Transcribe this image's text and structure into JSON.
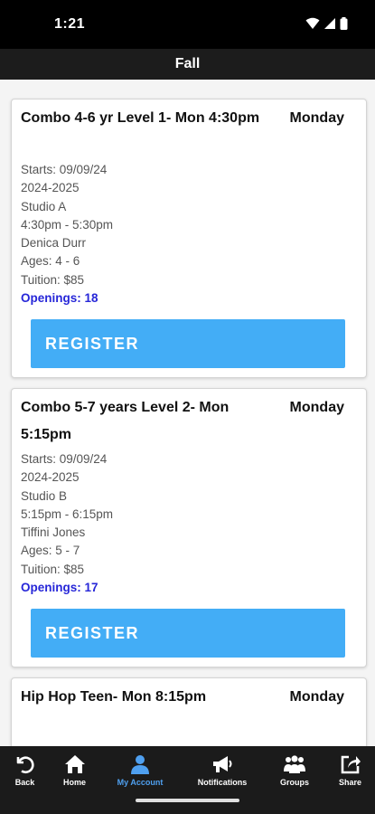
{
  "status_bar": {
    "time": "1:21"
  },
  "header": {
    "title": "Fall"
  },
  "classes": [
    {
      "title": "Combo 4-6 yr Level 1- Mon 4:30pm",
      "day": "Monday",
      "starts": "Starts: 09/09/24",
      "season": "2024-2025",
      "studio": "Studio A",
      "time": "4:30pm - 5:30pm",
      "instructor": "Denica Durr",
      "ages": "Ages: 4 - 6",
      "tuition": "Tuition: $85",
      "openings": "Openings: 18",
      "register_label": "REGISTER"
    },
    {
      "title": "Combo 5-7 years Level 2- Mon 5:15pm",
      "day": "Monday",
      "starts": "Starts: 09/09/24",
      "season": "2024-2025",
      "studio": "Studio B",
      "time": "5:15pm - 6:15pm",
      "instructor": "Tiffini Jones",
      "ages": "Ages: 5 - 7",
      "tuition": "Tuition: $85",
      "openings": "Openings: 17",
      "register_label": "REGISTER"
    },
    {
      "title": "Hip Hop Teen- Mon 8:15pm",
      "day": "Monday"
    }
  ],
  "bottom_nav": {
    "active_color": "#4fa0f0",
    "items": [
      {
        "label": "Back",
        "icon": "back-icon"
      },
      {
        "label": "Home",
        "icon": "home-icon"
      },
      {
        "label": "My Account",
        "icon": "account-icon",
        "active": true
      },
      {
        "label": "Notifications",
        "icon": "megaphone-icon"
      },
      {
        "label": "Groups",
        "icon": "groups-icon"
      },
      {
        "label": "Share",
        "icon": "share-icon"
      }
    ]
  },
  "colors": {
    "register": "#43adf6",
    "openings": "#2727d8"
  }
}
